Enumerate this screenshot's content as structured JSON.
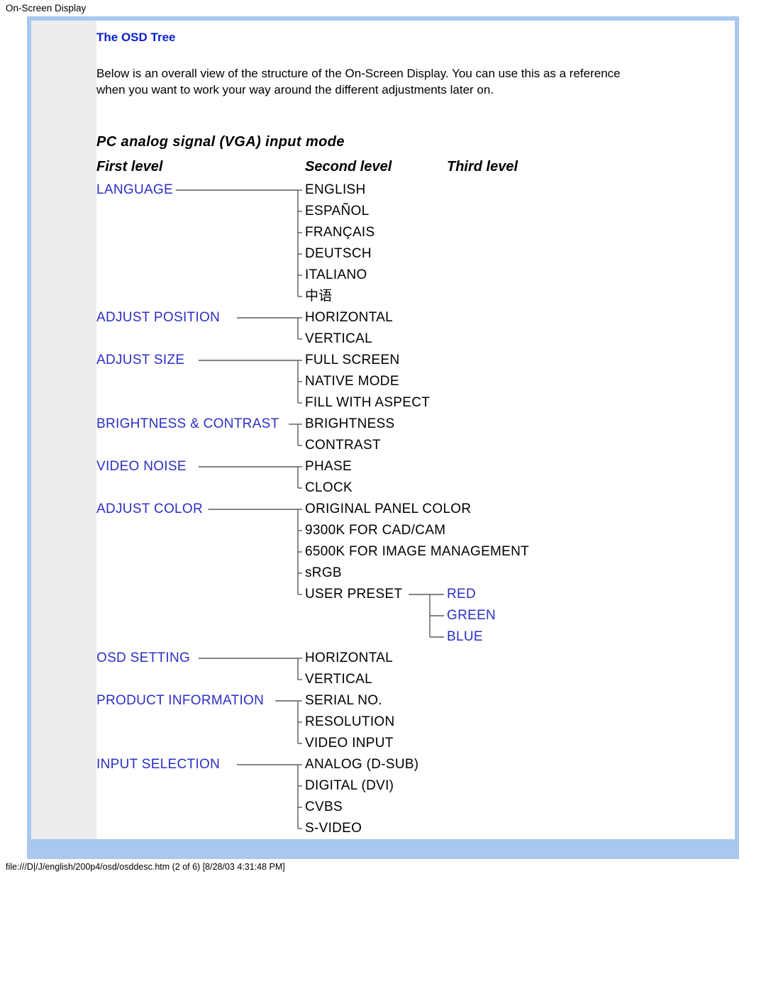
{
  "header": "On-Screen Display",
  "title": "The OSD Tree",
  "intro": "Below is an overall view of the structure of the On-Screen Display. You can use this as a reference when you want to work your way around the different adjustments later on.",
  "tree_heading": "PC analog signal (VGA) input mode",
  "levels": {
    "l1": "First level",
    "l2": "Second level",
    "l3": "Third level"
  },
  "tree": [
    {
      "label": "LANGUAGE",
      "children": [
        {
          "label": "ENGLISH"
        },
        {
          "label": "ESPAÑOL"
        },
        {
          "label": "FRANÇAIS"
        },
        {
          "label": "DEUTSCH"
        },
        {
          "label": "ITALIANO"
        },
        {
          "label": "中语"
        }
      ]
    },
    {
      "label": "ADJUST POSITION",
      "children": [
        {
          "label": "HORIZONTAL"
        },
        {
          "label": "VERTICAL"
        }
      ]
    },
    {
      "label": "ADJUST SIZE",
      "children": [
        {
          "label": "FULL SCREEN"
        },
        {
          "label": "NATIVE MODE"
        },
        {
          "label": "FILL WITH ASPECT"
        }
      ]
    },
    {
      "label": "BRIGHTNESS & CONTRAST",
      "children": [
        {
          "label": "BRIGHTNESS"
        },
        {
          "label": "CONTRAST"
        }
      ]
    },
    {
      "label": "VIDEO NOISE",
      "children": [
        {
          "label": "PHASE"
        },
        {
          "label": "CLOCK"
        }
      ]
    },
    {
      "label": "ADJUST COLOR",
      "children": [
        {
          "label": "ORIGINAL PANEL COLOR"
        },
        {
          "label": "9300K FOR CAD/CAM"
        },
        {
          "label": "6500K FOR IMAGE MANAGEMENT"
        },
        {
          "label": "sRGB"
        },
        {
          "label": "USER PRESET",
          "children": [
            {
              "label": "RED"
            },
            {
              "label": "GREEN"
            },
            {
              "label": "BLUE"
            }
          ]
        }
      ]
    },
    {
      "label": "OSD SETTING",
      "children": [
        {
          "label": "HORIZONTAL"
        },
        {
          "label": "VERTICAL"
        }
      ]
    },
    {
      "label": "PRODUCT INFORMATION",
      "children": [
        {
          "label": "SERIAL NO."
        },
        {
          "label": "RESOLUTION"
        },
        {
          "label": "VIDEO INPUT"
        }
      ]
    },
    {
      "label": "INPUT SELECTION",
      "children": [
        {
          "label": "ANALOG (D-SUB)"
        },
        {
          "label": "DIGITAL (DVI)"
        },
        {
          "label": "CVBS"
        },
        {
          "label": "S-VIDEO"
        }
      ]
    }
  ],
  "footer": "file:///D|/J/english/200p4/osd/osddesc.htm (2 of 6) [8/28/03 4:31:48 PM]"
}
